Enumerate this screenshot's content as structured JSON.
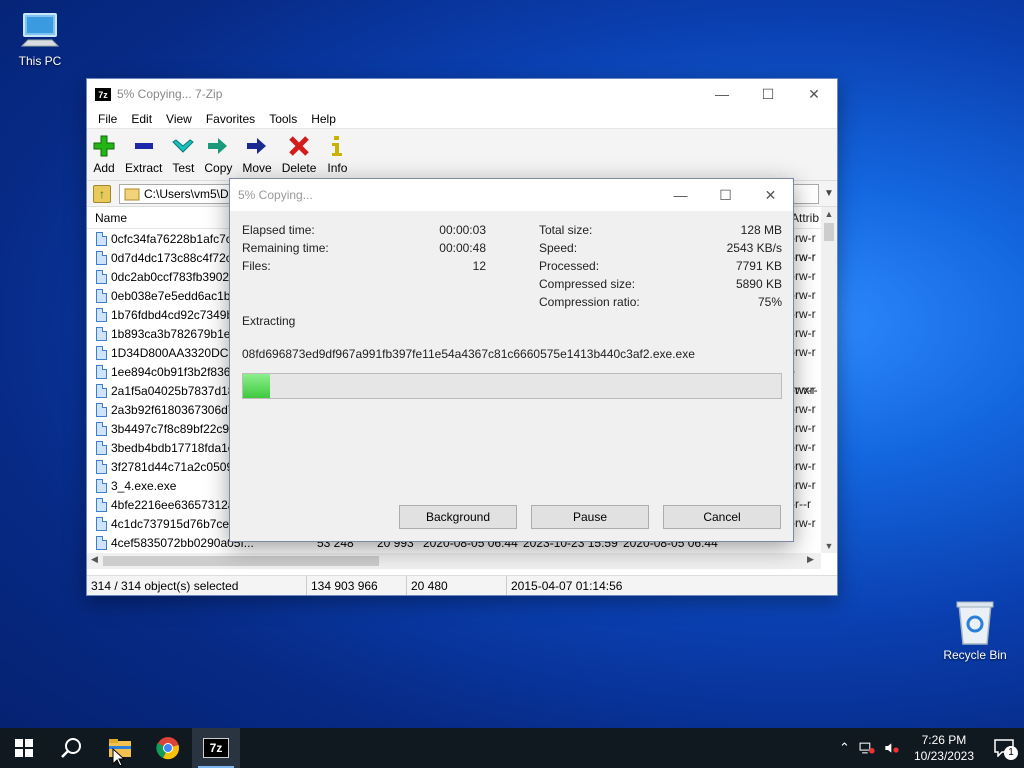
{
  "desktop": {
    "icons": [
      {
        "label": "This PC"
      },
      {
        "label": "Recycle Bin"
      }
    ]
  },
  "main_window": {
    "badge": "7z",
    "title": "5% Copying... 7-Zip",
    "menu": [
      "File",
      "Edit",
      "View",
      "Favorites",
      "Tools",
      "Help"
    ],
    "toolbar": [
      {
        "label": "Add",
        "icon": "plus-icon",
        "color": "#23b515"
      },
      {
        "label": "Extract",
        "icon": "minus-icon",
        "color": "#1a2aa8"
      },
      {
        "label": "Test",
        "icon": "check-icon",
        "color": "#19b3b0"
      },
      {
        "label": "Copy",
        "icon": "arrow-right-icon",
        "color": "#1a9a7a"
      },
      {
        "label": "Move",
        "icon": "arrow-right-icon",
        "color": "#1a2a90"
      },
      {
        "label": "Delete",
        "icon": "x-icon",
        "color": "#d41c1c"
      },
      {
        "label": "Info",
        "icon": "info-icon",
        "color": "#c8b400"
      }
    ],
    "address": "C:\\Users\\vm5\\D",
    "columns": {
      "name": "Name",
      "attrib": "Attrib"
    },
    "files": [
      {
        "name": "0cfc34fa76228b1afc7c",
        "attr": "-rw-r"
      },
      {
        "name": "0d7d4dc173c88c4f72c8",
        "attr": "-rw-r"
      },
      {
        "name": "0dc2ab0ccf783fb39028",
        "attr": "-rw-r"
      },
      {
        "name": "0eb038e7e5edd6ac1b4",
        "attr": "-rw-r"
      },
      {
        "name": "1b76fdbd4cd92c7349b",
        "attr": "-rw-r"
      },
      {
        "name": "1b893ca3b782679b1e5",
        "attr": "-rw-r"
      },
      {
        "name": "1D34D800AA3320DC17",
        "attr": "-rw-r"
      },
      {
        "name": "1ee894c0b91f3b2f8362",
        "attr": "-rwxr-"
      },
      {
        "name": "2a1f5a04025b7837d187",
        "attr": "-rw-r"
      },
      {
        "name": "2a3b92f6180367306d75",
        "attr": "-rw-r"
      },
      {
        "name": "3b4497c7f8c89bf22c98",
        "attr": "-rw-r"
      },
      {
        "name": "3bedb4bdb17718fda1e",
        "attr": "-rw-r"
      },
      {
        "name": "3f2781d44c71a2c05091",
        "attr": "-rw-r"
      },
      {
        "name": "3_4.exe.exe",
        "attr": "-rw-r"
      },
      {
        "name": "4bfe2216ee63657312af",
        "attr": "-r--r"
      },
      {
        "name": "4c1dc737915d76b7ce5",
        "attr": "-rw-r"
      }
    ],
    "last_row": {
      "name": "4cef5835072bb0290a05f...",
      "size": "53 248",
      "packed": "20 993",
      "modified": "2020-08-05 06:44",
      "created": "2023-10-23 15:59",
      "accessed": "2020-08-05 06:44",
      "attr": "-rw-r"
    },
    "status": {
      "selected": "314 / 314 object(s) selected",
      "size": "134 903 966",
      "packed": "20 480",
      "date": "2015-04-07 01:14:56"
    }
  },
  "progress_dialog": {
    "title": "5% Copying...",
    "elapsed_label": "Elapsed time:",
    "elapsed": "00:00:03",
    "remaining_label": "Remaining time:",
    "remaining": "00:00:48",
    "files_label": "Files:",
    "files": "12",
    "total_label": "Total size:",
    "total": "128 MB",
    "speed_label": "Speed:",
    "speed": "2543 KB/s",
    "processed_label": "Processed:",
    "processed": "7791 KB",
    "compressed_label": "Compressed size:",
    "compressed": "5890 KB",
    "ratio_label": "Compression ratio:",
    "ratio": "75%",
    "action": "Extracting",
    "current_file": "08fd696873ed9df967a991fb397fe11e54a4367c81c6660575e1413b440c3af2.exe.exe",
    "progress_fraction": 0.05,
    "buttons": {
      "background": "Background",
      "pause": "Pause",
      "cancel": "Cancel"
    }
  },
  "taskbar": {
    "time": "7:26 PM",
    "date": "10/23/2023",
    "pinned": [
      "start-icon",
      "search-icon",
      "file-explorer-icon",
      "chrome-icon",
      "7zip-icon"
    ],
    "notification_count": "1"
  }
}
